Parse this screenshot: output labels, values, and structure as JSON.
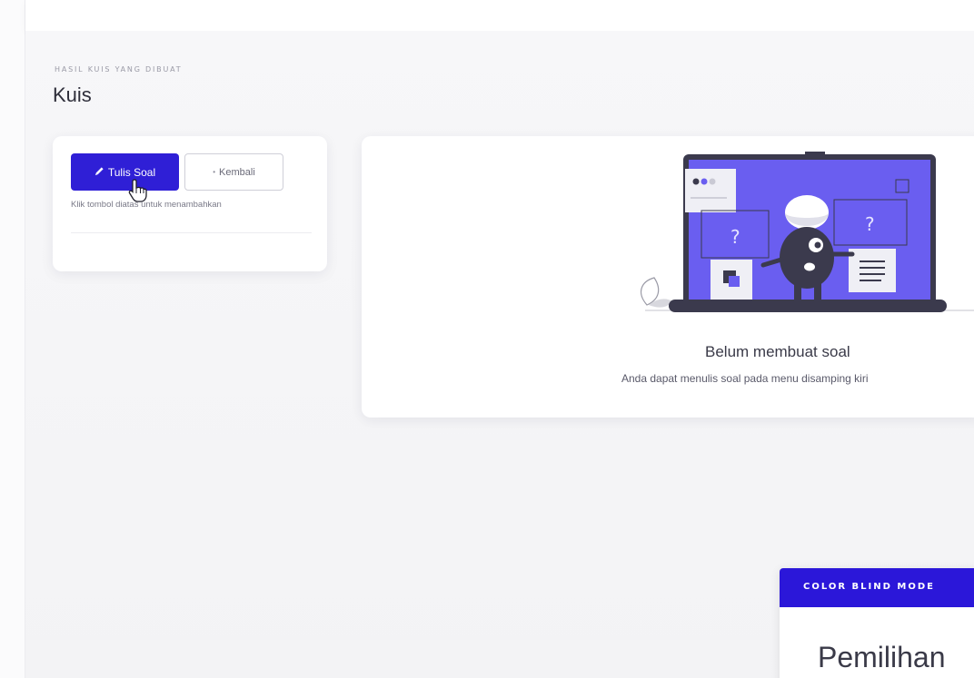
{
  "header": {
    "subtitle": "HASIL KUIS YANG DIBUAT",
    "title": "Kuis"
  },
  "actions": {
    "primary_label": "Tulis Soal",
    "secondary_label": "Kembali",
    "helper_text": "Klik tombol diatas untuk menambahkan"
  },
  "empty_state": {
    "title": "Belum membuat soal",
    "description": "Anda dapat menulis soal pada menu disamping kiri"
  },
  "color_blind_panel": {
    "header": "COLOR BLIND MODE",
    "heading": "Pemilihan"
  },
  "icons": {
    "primary_button_icon": "pencil-icon",
    "secondary_button_icon": "dot-icon",
    "cursor": "hand-pointer-icon"
  },
  "colors": {
    "primary": "#2f1fd6",
    "illustration_purple": "#6a5ef0",
    "dark": "#3b3a4d"
  }
}
